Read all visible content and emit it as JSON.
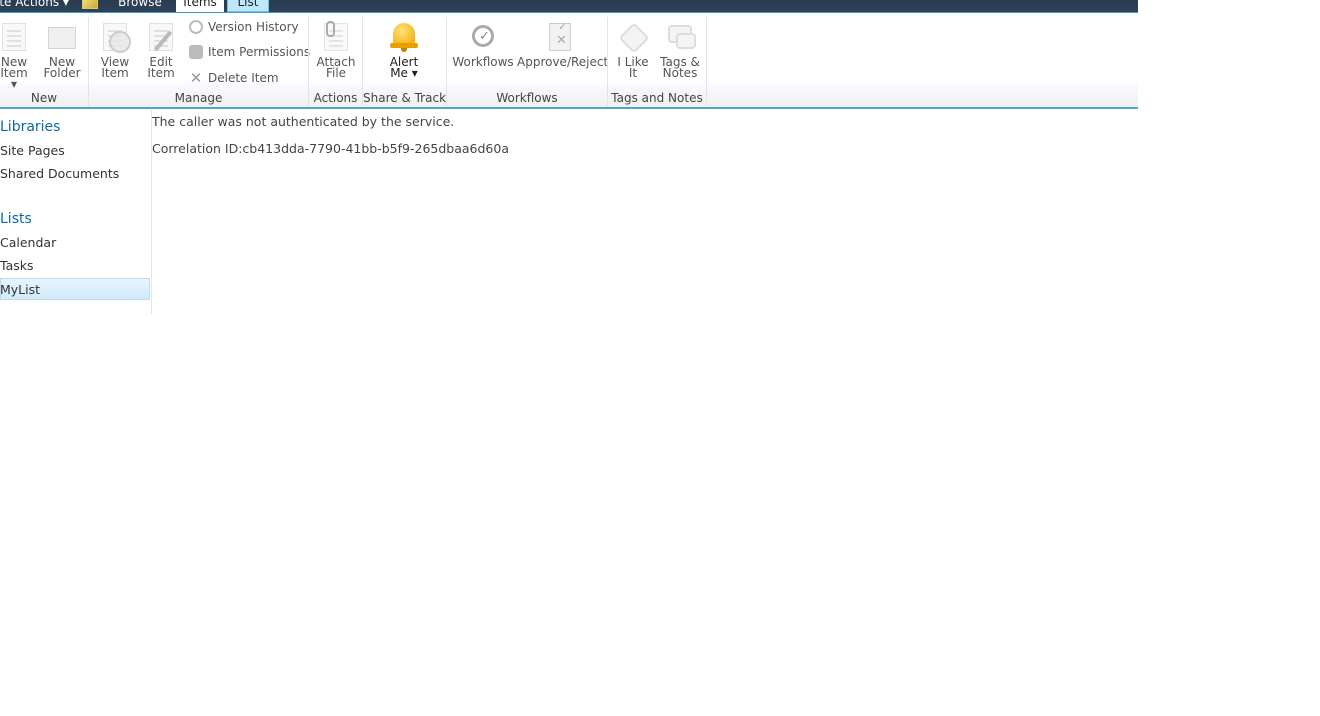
{
  "topbar": {
    "site_actions_label": "ite Actions ▾",
    "tabs": [
      {
        "label": "Browse"
      },
      {
        "label": "Items"
      },
      {
        "label": "List"
      }
    ]
  },
  "ribbon": {
    "groups": {
      "new": {
        "label": "New",
        "buttons": [
          {
            "label1": "New",
            "label2": "Item ▾"
          },
          {
            "label1": "New",
            "label2": "Folder"
          }
        ]
      },
      "manage": {
        "label": "Manage",
        "big_buttons": [
          {
            "label1": "View",
            "label2": "Item"
          },
          {
            "label1": "Edit",
            "label2": "Item"
          }
        ],
        "small_buttons": [
          {
            "label": "Version History"
          },
          {
            "label": "Item Permissions"
          },
          {
            "label": "Delete Item"
          }
        ]
      },
      "actions": {
        "label": "Actions",
        "buttons": [
          {
            "label1": "Attach",
            "label2": "File"
          }
        ]
      },
      "share": {
        "label": "Share & Track",
        "buttons": [
          {
            "label1": "Alert",
            "label2": "Me ▾"
          }
        ]
      },
      "workflows": {
        "label": "Workflows",
        "buttons": [
          {
            "label": "Workflows"
          },
          {
            "label": "Approve/Reject"
          }
        ]
      },
      "tags": {
        "label": "Tags and Notes",
        "buttons": [
          {
            "label1": "I Like",
            "label2": "It"
          },
          {
            "label1": "Tags &",
            "label2": "Notes"
          }
        ]
      }
    }
  },
  "nav": {
    "libraries_heading": "Libraries",
    "libraries": [
      {
        "label": "Site Pages"
      },
      {
        "label": "Shared Documents"
      }
    ],
    "lists_heading": "Lists",
    "lists": [
      {
        "label": "Calendar"
      },
      {
        "label": "Tasks"
      },
      {
        "label": "MyList",
        "selected": true
      }
    ]
  },
  "content": {
    "error_message": "The caller was not authenticated by the service.",
    "correlation_id": "Correlation ID:cb413dda-7790-41bb-b5f9-265dbaa6d60a"
  },
  "colors": {
    "topbar_bg": "#2e4257",
    "accent_line": "#4aa9c9",
    "nav_heading": "#0a6aa8",
    "selected_bg": "#d2eafb"
  }
}
